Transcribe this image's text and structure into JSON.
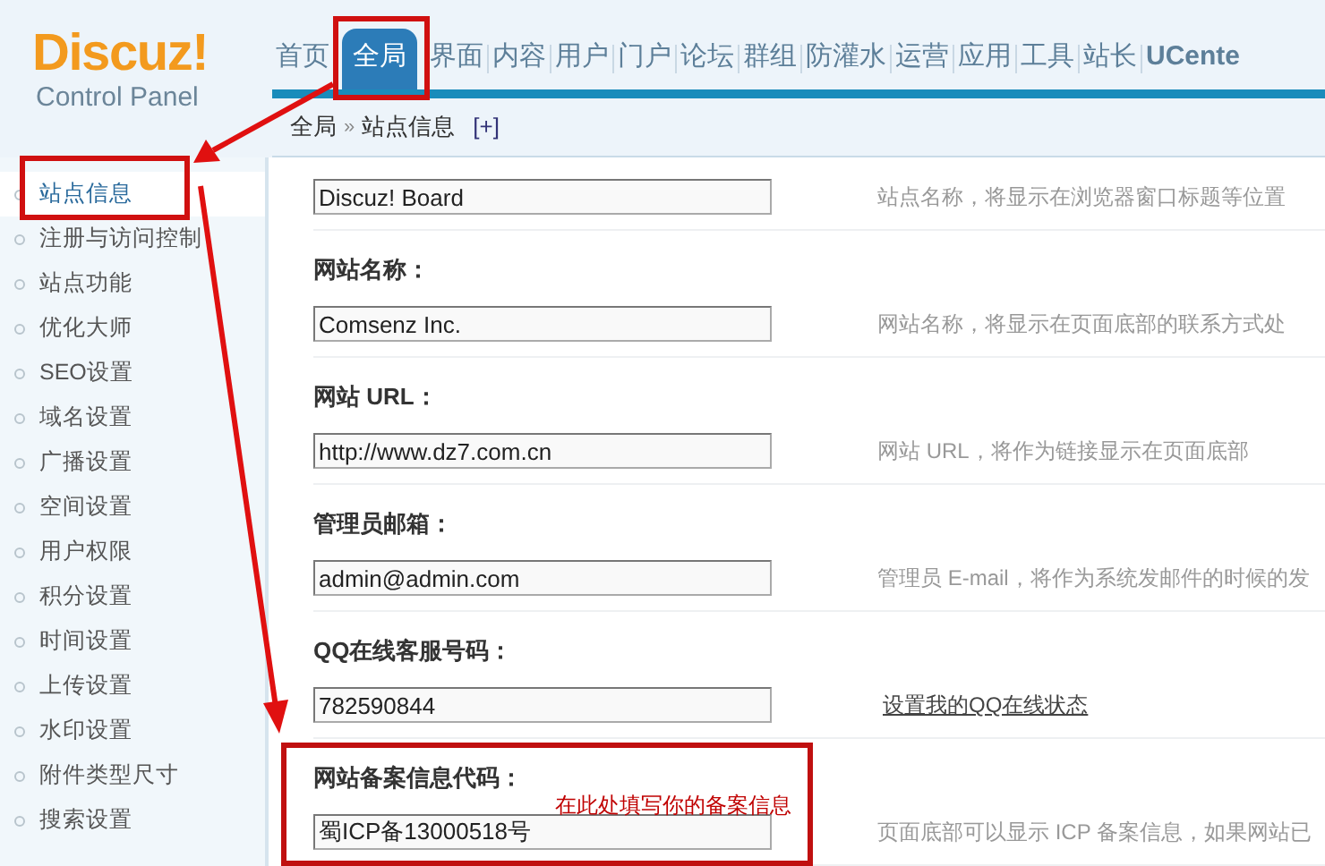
{
  "logo": {
    "name": "Discuz!",
    "subtitle": "Control Panel"
  },
  "nav": [
    {
      "label": "首页",
      "selected": false
    },
    {
      "label": "全局",
      "selected": true
    },
    {
      "label": "界面",
      "selected": false
    },
    {
      "label": "内容",
      "selected": false
    },
    {
      "label": "用户",
      "selected": false
    },
    {
      "label": "门户",
      "selected": false
    },
    {
      "label": "论坛",
      "selected": false
    },
    {
      "label": "群组",
      "selected": false
    },
    {
      "label": "防灌水",
      "selected": false
    },
    {
      "label": "运营",
      "selected": false
    },
    {
      "label": "应用",
      "selected": false
    },
    {
      "label": "工具",
      "selected": false
    },
    {
      "label": "站长",
      "selected": false
    },
    {
      "label": "UCente",
      "selected": false
    }
  ],
  "breadcrumb": {
    "items": [
      "全局",
      "站点信息"
    ],
    "separator": "»",
    "action": "[+]"
  },
  "sidebar": {
    "items": [
      {
        "label": "站点信息",
        "selected": true
      },
      {
        "label": "注册与访问控制",
        "selected": false
      },
      {
        "label": "站点功能",
        "selected": false
      },
      {
        "label": "优化大师",
        "selected": false
      },
      {
        "label": "SEO设置",
        "selected": false
      },
      {
        "label": "域名设置",
        "selected": false
      },
      {
        "label": "广播设置",
        "selected": false
      },
      {
        "label": "空间设置",
        "selected": false
      },
      {
        "label": "用户权限",
        "selected": false
      },
      {
        "label": "积分设置",
        "selected": false
      },
      {
        "label": "时间设置",
        "selected": false
      },
      {
        "label": "上传设置",
        "selected": false
      },
      {
        "label": "水印设置",
        "selected": false
      },
      {
        "label": "附件类型尺寸",
        "selected": false
      },
      {
        "label": "搜索设置",
        "selected": false
      }
    ]
  },
  "form": {
    "rows": [
      {
        "value": "Discuz! Board",
        "hint": "站点名称，将显示在浏览器窗口标题等位置"
      },
      {
        "label": "网站名称：",
        "value": "Comsenz Inc.",
        "hint": "网站名称，将显示在页面底部的联系方式处"
      },
      {
        "label": "网站 URL：",
        "value": "http://www.dz7.com.cn",
        "hint": "网站 URL，将作为链接显示在页面底部"
      },
      {
        "label": "管理员邮箱：",
        "value": "admin@admin.com",
        "hint": "管理员 E-mail，将作为系统发邮件的时候的发"
      },
      {
        "label": "QQ在线客服号码：",
        "value": "782590844",
        "link": "设置我的QQ在线状态"
      },
      {
        "label": "网站备案信息代码：",
        "value": "蜀ICP备13000518号",
        "hint": "页面底部可以显示 ICP 备案信息，如果网站已"
      }
    ]
  },
  "annotation": {
    "note": "在此处填写你的备案信息"
  }
}
